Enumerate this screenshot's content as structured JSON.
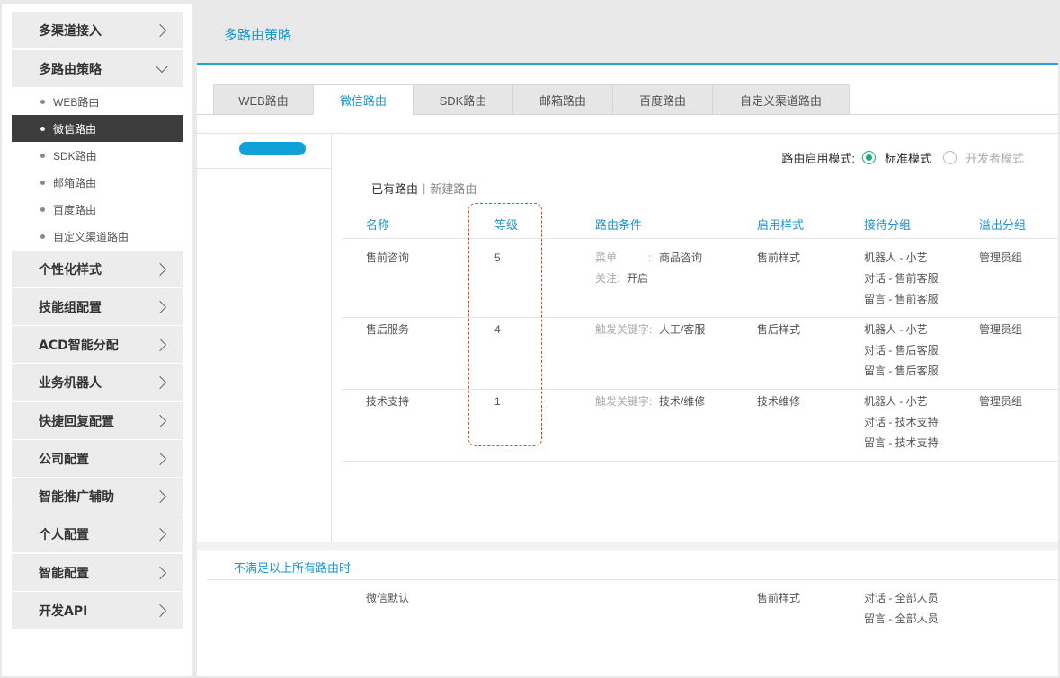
{
  "sidebar": {
    "groups": [
      {
        "label": "多渠道接入",
        "expanded": false
      },
      {
        "label": "多路由策略",
        "expanded": true
      },
      {
        "label": "个性化样式",
        "expanded": false
      },
      {
        "label": "技能组配置",
        "expanded": false
      },
      {
        "label": "ACD智能分配",
        "expanded": false
      },
      {
        "label": "业务机器人",
        "expanded": false
      },
      {
        "label": "快捷回复配置",
        "expanded": false
      },
      {
        "label": "公司配置",
        "expanded": false
      },
      {
        "label": "智能推广辅助",
        "expanded": false
      },
      {
        "label": "个人配置",
        "expanded": false
      },
      {
        "label": "智能配置",
        "expanded": false
      },
      {
        "label": "开发API",
        "expanded": false
      }
    ],
    "sub_items": [
      {
        "label": "WEB路由",
        "active": false
      },
      {
        "label": "微信路由",
        "active": true
      },
      {
        "label": "SDK路由",
        "active": false
      },
      {
        "label": "邮箱路由",
        "active": false
      },
      {
        "label": "百度路由",
        "active": false
      },
      {
        "label": "自定义渠道路由",
        "active": false
      }
    ]
  },
  "header": {
    "title": "多路由策略"
  },
  "tabs": [
    {
      "label": "WEB路由",
      "active": false
    },
    {
      "label": "微信路由",
      "active": true
    },
    {
      "label": "SDK路由",
      "active": false
    },
    {
      "label": "邮箱路由",
      "active": false
    },
    {
      "label": "百度路由",
      "active": false
    },
    {
      "label": "自定义渠道路由",
      "active": false
    }
  ],
  "mode": {
    "label": "路由启用模式:",
    "options": [
      "标准模式",
      "开发者模式"
    ],
    "selected": "标准模式"
  },
  "sub_links": {
    "existing": "已有路由",
    "separator": "|",
    "new": "新建路由"
  },
  "table": {
    "headers": {
      "name": "名称",
      "level": "等级",
      "condition": "路由条件",
      "style": "启用样式",
      "group": "接待分组",
      "overflow": "溢出分组"
    },
    "rows": [
      {
        "name": "售前咨询",
        "level": "5",
        "cond1_key": "菜单",
        "cond1_sep": ":",
        "cond1_val": "商品咨询",
        "cond2_key": "关注:",
        "cond2_val": "开启",
        "style": "售前样式",
        "group": [
          "机器人 - 小艺",
          "对话 - 售前客服",
          "留言 - 售前客服"
        ],
        "overflow": "管理员组"
      },
      {
        "name": "售后服务",
        "level": "4",
        "cond1_key": "触发关键字:",
        "cond1_val": "人工/客服",
        "style": "售后样式",
        "group": [
          "机器人 - 小艺",
          "对话 - 售后客服",
          "留言 - 售后客服"
        ],
        "overflow": "管理员组"
      },
      {
        "name": "技术支持",
        "level": "1",
        "cond1_key": "触发关键字:",
        "cond1_val": "技术/维修",
        "style": "技术维修",
        "group": [
          "机器人 - 小艺",
          "对话 - 技术支持",
          "留言 - 技术支持"
        ],
        "overflow": "管理员组"
      }
    ]
  },
  "fallback": {
    "title": "不满足以上所有路由时",
    "name": "微信默认",
    "style": "售前样式",
    "group": [
      "对话 - 全部人员",
      "留言 - 全部人员"
    ]
  },
  "colors": {
    "accent": "#1a96cf",
    "active_nav": "#3d3d3d",
    "radio_on": "#18b07a",
    "highlight": "#e04a1a"
  }
}
